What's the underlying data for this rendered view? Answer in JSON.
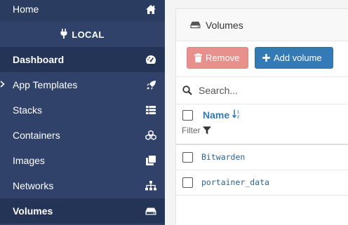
{
  "sidebar": {
    "home_label": "Home",
    "endpoint_label": "LOCAL",
    "items": [
      {
        "label": "Dashboard",
        "icon": "tachometer-icon"
      },
      {
        "label": "App Templates",
        "icon": "rocket-icon"
      },
      {
        "label": "Stacks",
        "icon": "list-icon"
      },
      {
        "label": "Containers",
        "icon": "cubes-icon"
      },
      {
        "label": "Images",
        "icon": "clone-icon"
      },
      {
        "label": "Networks",
        "icon": "sitemap-icon"
      },
      {
        "label": "Volumes",
        "icon": "hdd-icon"
      }
    ]
  },
  "panel": {
    "title": "Volumes",
    "remove_label": "Remove",
    "add_label": "Add volume",
    "search_placeholder": "Search..."
  },
  "table": {
    "name_header": "Name",
    "filter_label": "Filter",
    "rows": [
      "Bitwarden",
      "portainer_data"
    ]
  },
  "colors": {
    "sidebar_bg": "#30426a",
    "primary": "#337ab7",
    "danger_disabled": "#e8908c"
  }
}
